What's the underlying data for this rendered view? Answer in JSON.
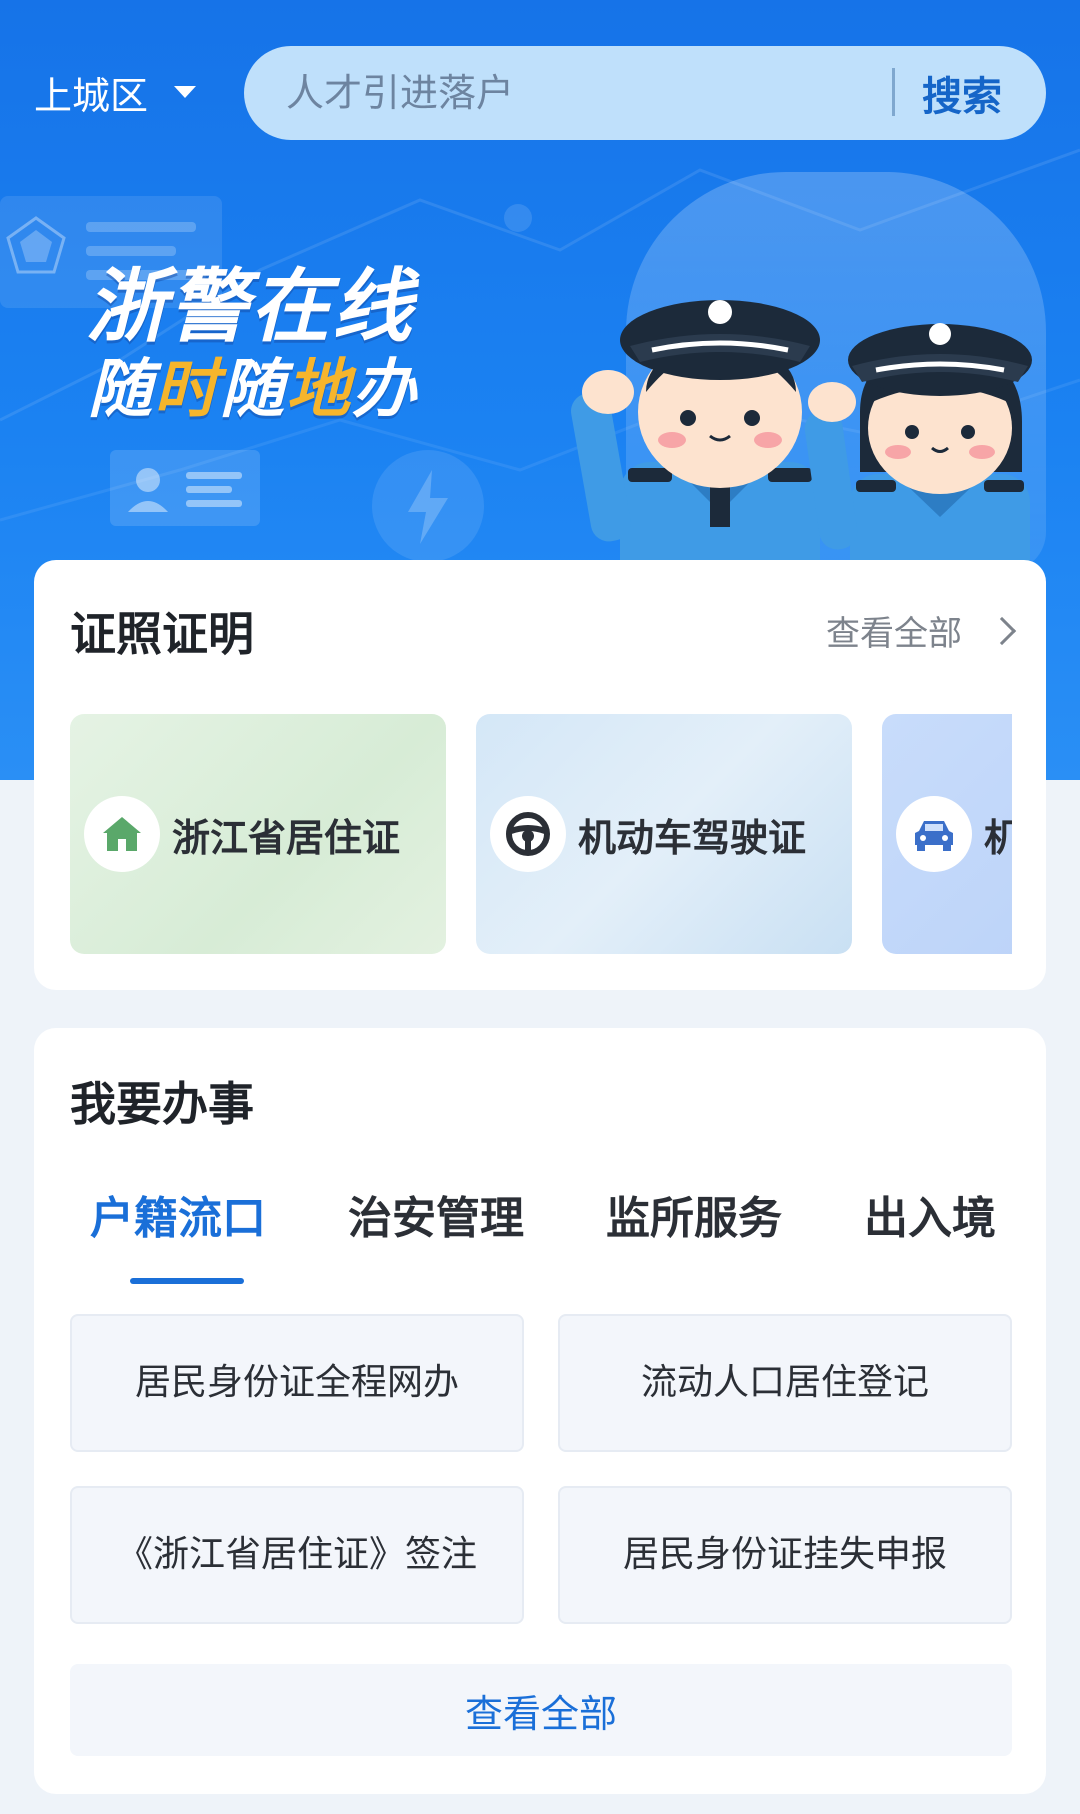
{
  "header": {
    "district": "上城区",
    "search_placeholder": "人才引进落户",
    "search_label": "搜索"
  },
  "banner": {
    "line1": "浙警在线",
    "line2_parts": [
      "随",
      "时",
      "随",
      "地",
      "办"
    ]
  },
  "certificates": {
    "title": "证照证明",
    "view_all": "查看全部",
    "items": [
      {
        "label": "浙江省居住证",
        "icon": "home-icon"
      },
      {
        "label": "机动车驾驶证",
        "icon": "steering-wheel-icon"
      },
      {
        "label": "机",
        "icon": "car-icon"
      }
    ]
  },
  "affairs": {
    "title": "我要办事",
    "tabs": [
      "户籍流口",
      "治安管理",
      "监所服务",
      "出入境"
    ],
    "active_tab": "户籍流口",
    "services": [
      "居民身份证全程网办",
      "流动人口居住登记",
      "《浙江省居住证》签注",
      "居民身份证挂失申报"
    ],
    "view_all": "查看全部"
  },
  "colors": {
    "brand_blue": "#1a6fd8",
    "hero_blue": "#1673e8",
    "accent_orange": "#f6b52c"
  }
}
